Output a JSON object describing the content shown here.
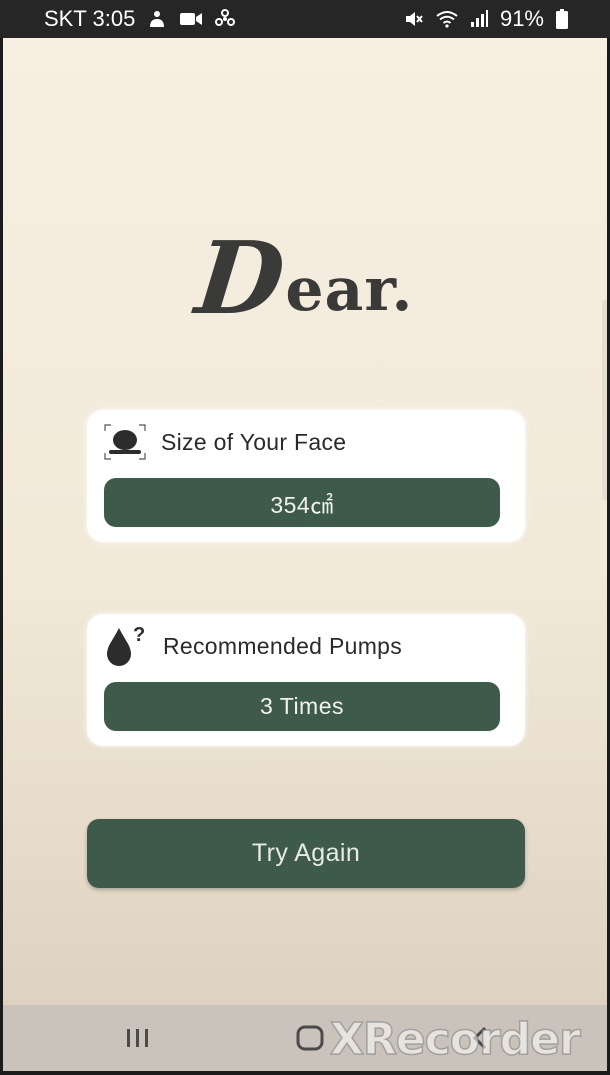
{
  "status_bar": {
    "carrier_time": "SKT 3:05",
    "battery": "91%",
    "left_icons": [
      "notification-icon",
      "video-record-icon",
      "fan-icon"
    ],
    "right_icons": [
      "mute-icon",
      "wifi-icon",
      "signal-icon",
      "battery-icon"
    ]
  },
  "app": {
    "logo_initial": "D",
    "logo_rest": "ear."
  },
  "face_card": {
    "icon": "face-scan-icon",
    "title": "Size of Your Face",
    "value": "354㎠"
  },
  "pumps_card": {
    "icon": "drop-question-icon",
    "title": "Recommended Pumps",
    "value": "3 Times"
  },
  "actions": {
    "try_again_label": "Try Again"
  },
  "nav_bar": {
    "icons": [
      "recents-icon",
      "home-icon",
      "back-icon"
    ]
  },
  "watermark": {
    "text": "XRecorder"
  },
  "colors": {
    "accent_green": "#3e5a4a",
    "background_cream": "#f4ecdd",
    "card_white": "#ffffff",
    "logo_dark": "#3a3a38"
  }
}
